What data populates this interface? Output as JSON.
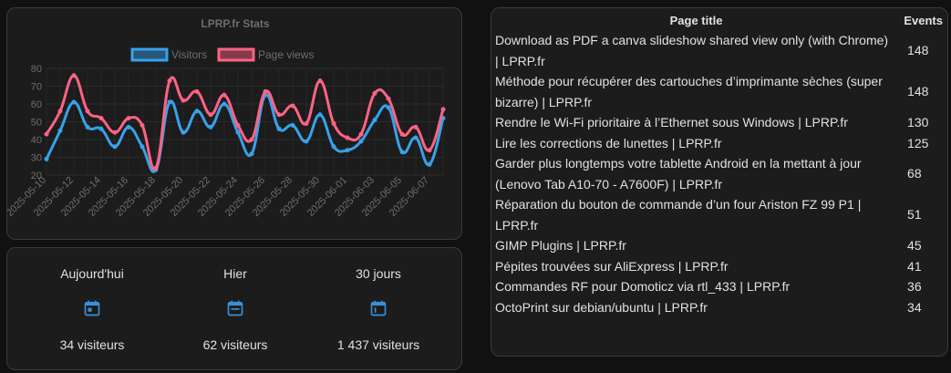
{
  "chart_card": {
    "title": "LPRP.fr Stats",
    "legend": [
      {
        "label": "Visitors",
        "color": "#36a2eb"
      },
      {
        "label": "Page views",
        "color": "#ff6384"
      }
    ]
  },
  "chart_data": {
    "type": "line",
    "title": "LPRP.fr Stats",
    "xlabel": "",
    "ylabel": "",
    "ylim": [
      20,
      80
    ],
    "yticks": [
      20,
      30,
      40,
      50,
      60,
      70,
      80
    ],
    "grid": true,
    "legend_position": "top",
    "x": [
      "2025-05-10",
      "2025-05-11",
      "2025-05-12",
      "2025-05-13",
      "2025-05-14",
      "2025-05-15",
      "2025-05-16",
      "2025-05-17",
      "2025-05-18",
      "2025-05-19",
      "2025-05-20",
      "2025-05-21",
      "2025-05-22",
      "2025-05-23",
      "2025-05-24",
      "2025-05-25",
      "2025-05-26",
      "2025-05-27",
      "2025-05-28",
      "2025-05-29",
      "2025-05-30",
      "2025-05-31",
      "2025-06-01",
      "2025-06-02",
      "2025-06-03",
      "2025-06-04",
      "2025-06-05",
      "2025-06-06",
      "2025-06-07",
      "2025-06-08"
    ],
    "xtick_labels": [
      "2025-05-10",
      "2025-05-12",
      "2025-05-14",
      "2025-05-16",
      "2025-05-18",
      "2025-05-20",
      "2025-05-22",
      "2025-05-24",
      "2025-05-26",
      "2025-05-28",
      "2025-05-30",
      "2025-06-01",
      "2025-06-03",
      "2025-06-05",
      "2025-06-07"
    ],
    "series": [
      {
        "name": "Visitors",
        "color": "#36a2eb",
        "values": [
          29,
          45,
          61,
          47,
          46,
          36,
          47,
          36,
          23,
          61,
          44,
          56,
          47,
          60,
          44,
          32,
          65,
          46,
          48,
          39,
          54,
          36,
          34,
          39,
          51,
          58,
          33,
          41,
          26,
          52
        ]
      },
      {
        "name": "Page views",
        "color": "#ff6384",
        "values": [
          43,
          56,
          76,
          56,
          52,
          44,
          52,
          48,
          24,
          73,
          62,
          67,
          54,
          65,
          48,
          40,
          67,
          54,
          59,
          49,
          73,
          49,
          41,
          43,
          66,
          63,
          43,
          47,
          34,
          57
        ]
      }
    ]
  },
  "stats": [
    {
      "label": "Aujourd'hui",
      "value": "34 visiteurs",
      "icon": "calendar-today-icon"
    },
    {
      "label": "Hier",
      "value": "62 visiteurs",
      "icon": "calendar-yesterday-icon"
    },
    {
      "label": "30 jours",
      "value": "1 437 visiteurs",
      "icon": "calendar-month-icon"
    }
  ],
  "table": {
    "headers": {
      "title": "Page title",
      "events": "Events"
    },
    "rows": [
      {
        "title": "Download as PDF a canva slideshow shared view only (with Chrome) | LPRP.fr",
        "events": "148"
      },
      {
        "title": "Méthode pour récupérer des cartouches d’imprimante sèches (super bizarre) | LPRP.fr",
        "events": "148"
      },
      {
        "title": "Rendre le Wi-Fi prioritaire à l’Ethernet sous Windows | LPRP.fr",
        "events": "130"
      },
      {
        "title": "Lire les corrections de lunettes | LPRP.fr",
        "events": "125"
      },
      {
        "title": "Garder plus longtemps votre tablette Android en la mettant à jour (Lenovo Tab A10-70 - A7600F) | LPRP.fr",
        "events": "68"
      },
      {
        "title": "Réparation du bouton de commande d’un four Ariston FZ 99 P1 | LPRP.fr",
        "events": "51"
      },
      {
        "title": "GIMP Plugins | LPRP.fr",
        "events": "45"
      },
      {
        "title": "Pépites trouvées sur AliExpress | LPRP.fr",
        "events": "41"
      },
      {
        "title": "Commandes RF pour Domoticz via rtl_433 | LPRP.fr",
        "events": "36"
      },
      {
        "title": "OctoPrint sur debian/ubuntu | LPRP.fr",
        "events": "34"
      }
    ]
  }
}
